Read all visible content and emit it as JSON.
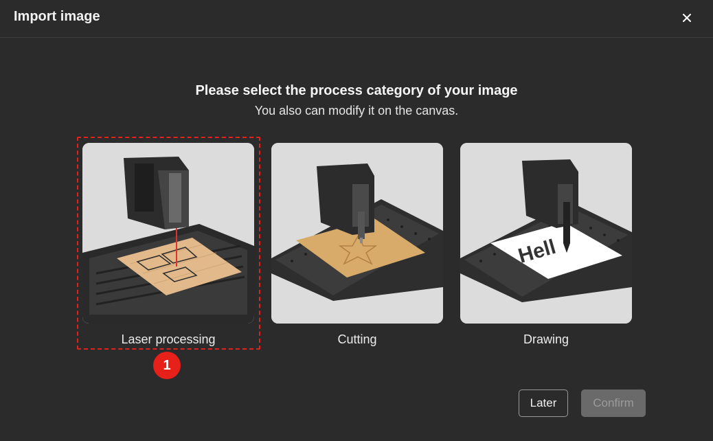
{
  "dialog": {
    "title": "Import image"
  },
  "prompt": {
    "heading": "Please select the process category of your image",
    "subheading": "You also can modify it on the canvas."
  },
  "categories": [
    {
      "label": "Laser processing",
      "selected": true
    },
    {
      "label": "Cutting",
      "selected": false
    },
    {
      "label": "Drawing",
      "selected": false
    }
  ],
  "annotation": {
    "step_number": "1",
    "color": "#e8201a"
  },
  "drawing_sample_text": "Hell",
  "buttons": {
    "later": "Later",
    "confirm": "Confirm",
    "confirm_enabled": false
  },
  "colors": {
    "background": "#2b2b2b",
    "card_background": "#dedede",
    "wood": "#e2b98a",
    "kraft": "#d9ab6a"
  }
}
